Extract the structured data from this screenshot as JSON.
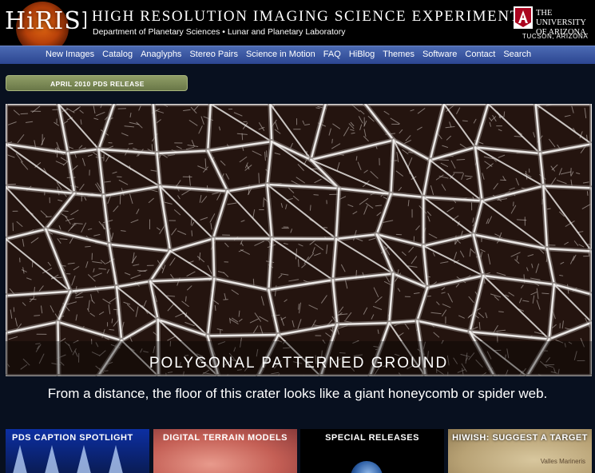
{
  "header": {
    "logo_text": "HiRISE",
    "title": "HIGH RESOLUTION IMAGING SCIENCE EXPERIMENT",
    "subtitle": "Department of Planetary Sciences • Lunar and Planetary Laboratory",
    "university": "THE UNIVERSITY OF ARIZONA.",
    "city": "TUCSON, ARIZONA"
  },
  "nav": {
    "items": [
      "New Images",
      "Catalog",
      "Anaglyphs",
      "Stereo Pairs",
      "Science in Motion",
      "FAQ",
      "HiBlog",
      "Themes",
      "Software",
      "Contact",
      "Search"
    ]
  },
  "release_label": "APRIL 2010 PDS RELEASE",
  "feature": {
    "title": "POLYGONAL PATTERNED GROUND",
    "caption": "From a distance, the floor of this crater looks like a giant honeycomb or spider web."
  },
  "tiles": [
    {
      "label": "PDS CAPTION SPOTLIGHT"
    },
    {
      "label": "DIGITAL TERRAIN MODELS"
    },
    {
      "label": "SPECIAL RELEASES"
    },
    {
      "label": "HIWISH: SUGGEST A TARGET",
      "sublabel": "Valles Marineris"
    }
  ],
  "colors": {
    "background": "#08101f",
    "nav": "#2c4691",
    "release_bar": "#7a8856"
  }
}
